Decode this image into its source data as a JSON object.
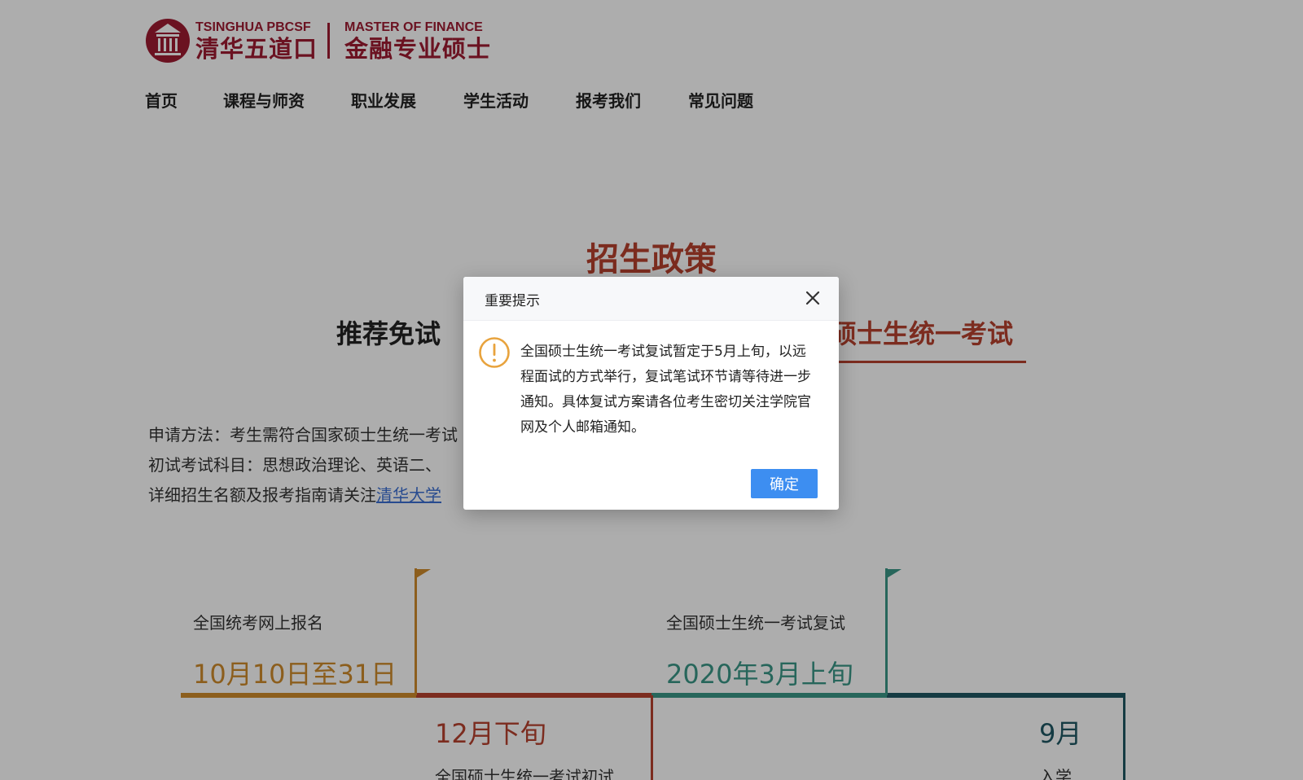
{
  "header": {
    "logo": {
      "en_left": "TSINGHUA PBCSF",
      "cn_left": "清华五道口",
      "en_right": "MASTER OF FINANCE",
      "cn_right": "金融专业硕士",
      "brand_color": "#9e1b32"
    },
    "nav": [
      {
        "label": "首页"
      },
      {
        "label": "课程与师资"
      },
      {
        "label": "职业发展"
      },
      {
        "label": "学生活动"
      },
      {
        "label": "报考我们"
      },
      {
        "label": "常见问题"
      }
    ]
  },
  "main": {
    "section_title": "招生政策",
    "tabs": [
      {
        "label": "推荐免试",
        "active": false
      },
      {
        "label": "全国硕士生统一考试",
        "active": true
      }
    ],
    "info": {
      "line1": "申请方法：考生需符合国家硕士生统一考试",
      "line2": "初试考试科目：思想政治理论、英语二、",
      "line3_prefix": "详细招生名额及报考指南请关注",
      "line3_link": "清华大学"
    },
    "timeline": [
      {
        "label": "全国统考网上报名",
        "date": "10月10日至31日",
        "color": "#cf8b2b"
      },
      {
        "label": "全国硕士生统一考试初试",
        "date": "12月下旬",
        "color": "#b7412e"
      },
      {
        "label": "全国硕士生统一考试复试",
        "date": "2020年3月上旬",
        "color": "#3a9787"
      },
      {
        "label": "入学",
        "date": "9月",
        "color": "#1f5864"
      }
    ]
  },
  "modal": {
    "title": "重要提示",
    "message": "全国硕士生统一考试复试暂定于5月上旬，以远程面试的方式举行，复试笔试环节请等待进一步通知。具体复试方案请各位考生密切关注学院官网及个人邮箱通知。",
    "confirm_label": "确定",
    "warning_color": "#e8a33d",
    "button_color": "#3d8ef1"
  }
}
